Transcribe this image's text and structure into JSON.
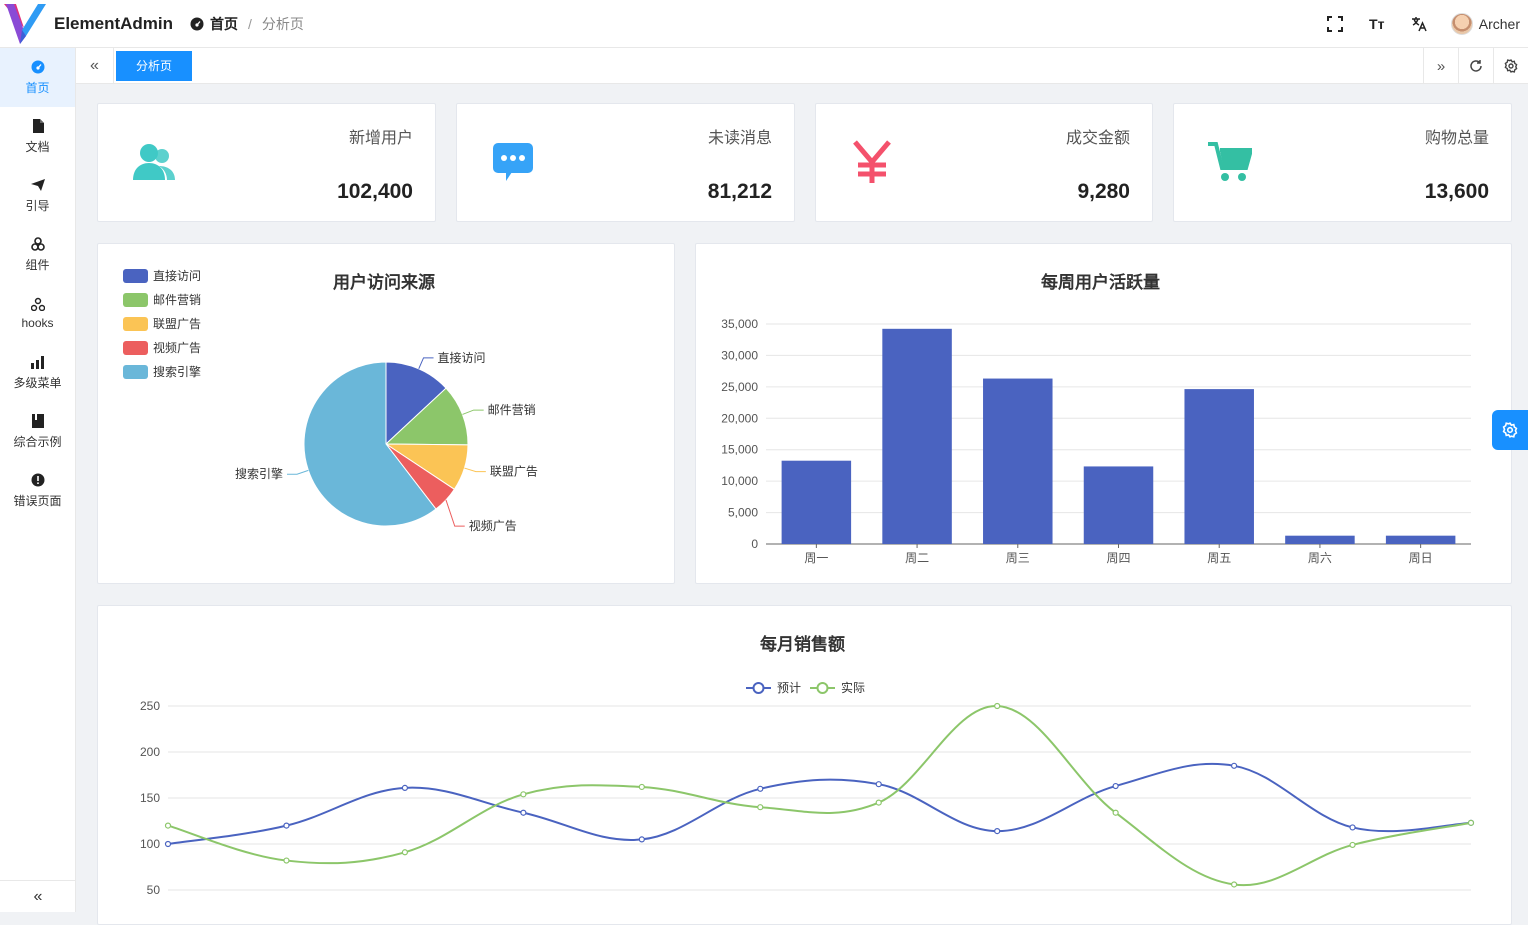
{
  "header": {
    "app_title": "ElementAdmin",
    "breadcrumb_home": "首页",
    "breadcrumb_sep": "/",
    "breadcrumb_current": "分析页",
    "font_size_icon_text": "Tт",
    "user_name": "Archer"
  },
  "sidebar": {
    "items": [
      {
        "label": "首页",
        "icon": "dashboard-icon",
        "active": true
      },
      {
        "label": "文档",
        "icon": "document-icon"
      },
      {
        "label": "引导",
        "icon": "send-icon"
      },
      {
        "label": "组件",
        "icon": "component-icon"
      },
      {
        "label": "hooks",
        "icon": "hooks-icon"
      },
      {
        "label": "多级菜单",
        "icon": "bar-chart-icon"
      },
      {
        "label": "综合示例",
        "icon": "book-icon"
      },
      {
        "label": "错误页面",
        "icon": "error-icon"
      }
    ]
  },
  "tabs": {
    "items": [
      {
        "label": "分析页"
      }
    ]
  },
  "stats": [
    {
      "label": "新增用户",
      "value": "102,400",
      "icon": "users-icon",
      "color": "#40c9c6"
    },
    {
      "label": "未读消息",
      "value": "81,212",
      "icon": "message-icon",
      "color": "#36a3f7"
    },
    {
      "label": "成交金额",
      "value": "9,280",
      "icon": "yen-icon",
      "color": "#f4516c"
    },
    {
      "label": "购物总量",
      "value": "13,600",
      "icon": "cart-icon",
      "color": "#34bfa3"
    }
  ],
  "chart_data": [
    {
      "type": "pie",
      "title": "用户访问来源",
      "legend_position": "top-left",
      "categories": [
        "直接访问",
        "邮件营销",
        "联盟广告",
        "视频广告",
        "搜索引擎"
      ],
      "values": [
        335,
        310,
        234,
        135,
        1548
      ],
      "colors": [
        "#4a63c0",
        "#8cc66a",
        "#fbc455",
        "#ec5e5e",
        "#6ab7d9"
      ]
    },
    {
      "type": "bar",
      "title": "每周用户活跃量",
      "categories": [
        "周一",
        "周二",
        "周三",
        "周四",
        "周五",
        "周六",
        "周日"
      ],
      "values": [
        13253,
        34235,
        26321,
        12340,
        24643,
        1322,
        1324
      ],
      "ylim": [
        0,
        35000
      ],
      "yticks": [
        "0",
        "5,000",
        "10,000",
        "15,000",
        "20,000",
        "25,000",
        "30,000",
        "35,000"
      ],
      "color": "#4a63c0",
      "grid": true
    },
    {
      "type": "line",
      "title": "每月销售额",
      "legend_position": "top-center",
      "ylim": [
        50,
        250
      ],
      "yticks": [
        "50",
        "100",
        "150",
        "200",
        "250"
      ],
      "grid": true,
      "series": [
        {
          "name": "预计",
          "color": "#4a63c0",
          "values": [
            100,
            120,
            161,
            134,
            105,
            160,
            165,
            114,
            163,
            185,
            118,
            123
          ]
        },
        {
          "name": "实际",
          "color": "#8cc66a",
          "values": [
            120,
            82,
            91,
            154,
            162,
            140,
            145,
            250,
            134,
            56,
            99,
            123
          ]
        }
      ]
    }
  ]
}
